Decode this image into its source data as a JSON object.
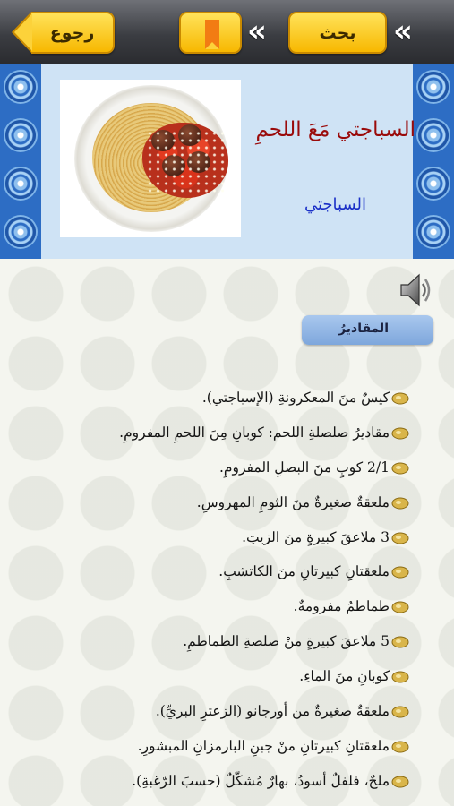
{
  "toolbar": {
    "back_label": "رجوع",
    "search_label": "بحث",
    "prev_icon": "double-chevron-left-icon",
    "next_icon": "double-chevron-right-icon",
    "bookmark_icon": "bookmark-icon",
    "prev_glyph": "«",
    "next_glyph": "«"
  },
  "recipe": {
    "title": "السباجتي مَعَ اللحمِ",
    "category": "السباجتي"
  },
  "section": {
    "label": "المقاديرُ"
  },
  "ingredients": [
    "كيسٌ منَ المعكرونةِ (الإسباجتي).",
    "مقاديرُ صلصلةِ اللحم: كوبانِ مِنَ اللحمِ المفرومِ.",
    "2/1 كوبٍ منَ البصلِ المفرومِ.",
    "ملعقةٌ صغيرةٌ منَ الثومِ المهروسِ.",
    "3 ملاعقَ كبيرةٍ منَ الزيتِ.",
    "ملعقتانِ كبيرتانِ منَ الكاتشبِ.",
    "طماطمُ مفرومةٌ.",
    "5 ملاعقَ كبيرةٍ منْ صلصةِ الطماطمِ.",
    "كوبانِ منَ الماءِ.",
    "ملعقةٌ صغيرةٌ من أورجانو (الزعترِ البريِّ).",
    "ملعقتانِ كبيرتانِ منْ جبنِ البارمزانِ المبشورِ.",
    "ملحٌ، فلفلٌ أسودُ، بهارٌ مُشكّلٌ (حسبَ الرّغبةِ)."
  ],
  "colors": {
    "toolbar": "#3b3d42",
    "button_yellow": "#fcd23a",
    "border_blue": "#2d6dc4",
    "header_bg": "#cfe3f5",
    "title_red": "#9a0b0b",
    "category_blue": "#1a2fc7"
  }
}
